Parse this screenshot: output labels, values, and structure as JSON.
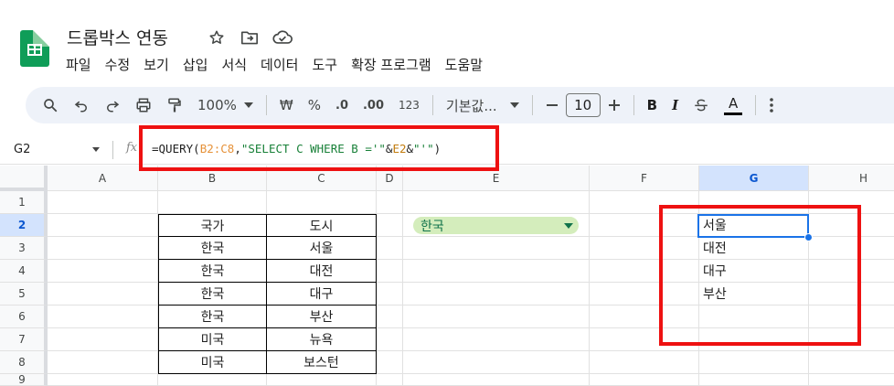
{
  "app": {
    "doc_title": "드롭박스 연동",
    "title_icons": [
      "star-icon",
      "move-to-folder-icon",
      "cloud-status-icon"
    ]
  },
  "menu": [
    "파일",
    "수정",
    "보기",
    "삽입",
    "서식",
    "데이터",
    "도구",
    "확장 프로그램",
    "도움말"
  ],
  "toolbar": {
    "zoom": "100%",
    "currency": "₩",
    "percent": "%",
    "dec_decrease": ".0",
    "dec_increase": ".00",
    "number_format": "123",
    "font": "기본값...",
    "font_size": "10",
    "bold": "B",
    "italic": "I",
    "text_color": "A"
  },
  "formula_bar": {
    "name_box": "G2",
    "fx": "fx",
    "formula_parts": [
      "=QUERY(",
      "B2:C8",
      ",",
      "\"SELECT C WHERE B ='\"",
      "&",
      "E2",
      "&",
      "\"'\"",
      ")"
    ]
  },
  "columns": [
    "A",
    "B",
    "C",
    "D",
    "E",
    "F",
    "G",
    "H"
  ],
  "rows": [
    "1",
    "2",
    "3",
    "4",
    "5",
    "6",
    "7",
    "8",
    "9"
  ],
  "selected_cell": {
    "col": "G",
    "row": "2"
  },
  "table": {
    "header": [
      "국가",
      "도시"
    ],
    "rows": [
      [
        "한국",
        "서울"
      ],
      [
        "한국",
        "대전"
      ],
      [
        "한국",
        "대구"
      ],
      [
        "한국",
        "부산"
      ],
      [
        "미국",
        "뉴욕"
      ],
      [
        "미국",
        "보스턴"
      ]
    ]
  },
  "dropdown_e2": "한국",
  "result_g": [
    "서울",
    "대전",
    "대구",
    "부산"
  ],
  "colors": {
    "sheets_green": "#0f9d58",
    "chip_bg": "#d4edbc",
    "chip_text": "#11734b",
    "selection_blue": "#1a73e8",
    "annotation_red": "#ee1111"
  }
}
